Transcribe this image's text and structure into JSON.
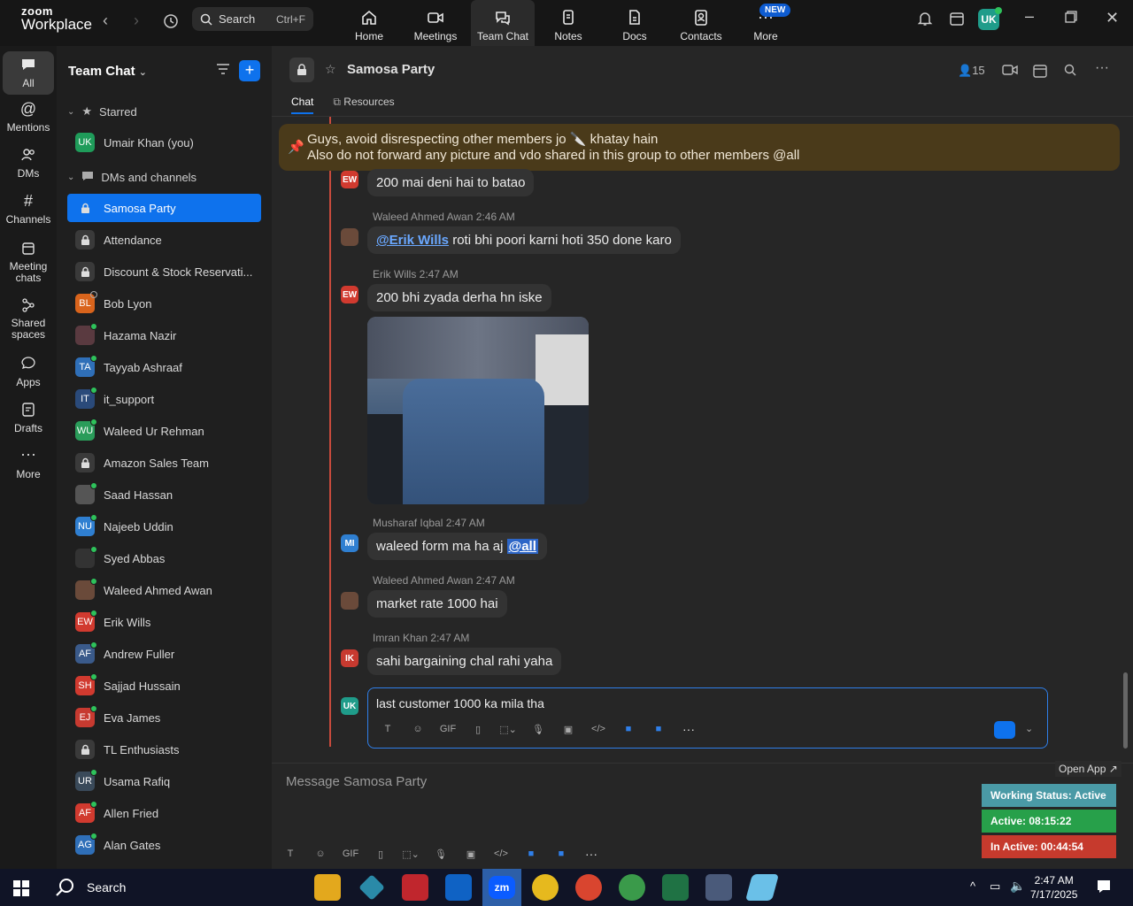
{
  "app": {
    "logo_top": "zoom",
    "logo_bottom": "Workplace"
  },
  "topbar": {
    "search_label": "Search",
    "search_shortcut": "Ctrl+F",
    "tabs": [
      {
        "label": "Home"
      },
      {
        "label": "Meetings"
      },
      {
        "label": "Team Chat"
      },
      {
        "label": "Notes"
      },
      {
        "label": "Docs"
      },
      {
        "label": "Contacts"
      },
      {
        "label": "More"
      }
    ],
    "new_badge": "NEW",
    "user_initials": "UK"
  },
  "rail": {
    "items": [
      {
        "label": "All"
      },
      {
        "label": "Mentions"
      },
      {
        "label": "DMs"
      },
      {
        "label": "Channels"
      },
      {
        "label": "Meeting chats"
      },
      {
        "label": "Shared spaces"
      },
      {
        "label": "Apps"
      },
      {
        "label": "Drafts"
      },
      {
        "label": "More"
      }
    ]
  },
  "sidebar": {
    "title": "Team Chat",
    "starred_label": "Starred",
    "dms_label": "DMs and channels",
    "starred_item": {
      "initials": "UK",
      "name": "Umair Khan (you)",
      "color": "#1f9c5a"
    },
    "items": [
      {
        "name": "Samosa Party",
        "type": "lock"
      },
      {
        "name": "Attendance",
        "type": "lock"
      },
      {
        "name": "Discount & Stock Reservati...",
        "type": "lock"
      },
      {
        "name": "Bob Lyon",
        "initials": "BL",
        "color": "#d9641c",
        "status": "off"
      },
      {
        "name": "Hazama Nazir",
        "initials": "",
        "color": "#5a3a40",
        "status": "on"
      },
      {
        "name": "Tayyab Ashraaf",
        "initials": "TA",
        "color": "#2f6fb8",
        "status": "on"
      },
      {
        "name": "it_support",
        "initials": "IT",
        "color": "#2a4a7a",
        "status": "on"
      },
      {
        "name": "Waleed Ur Rehman",
        "initials": "WU",
        "color": "#2a9c5a",
        "status": "on"
      },
      {
        "name": "Amazon Sales Team",
        "type": "lock"
      },
      {
        "name": "Saad Hassan",
        "initials": "",
        "color": "#555",
        "status": "on"
      },
      {
        "name": "Najeeb Uddin",
        "initials": "NU",
        "color": "#2f7fd1",
        "status": "on"
      },
      {
        "name": "Syed Abbas",
        "initials": "",
        "color": "#333",
        "status": "on"
      },
      {
        "name": "Waleed Ahmed Awan",
        "initials": "",
        "color": "#6a4a3a",
        "status": "on"
      },
      {
        "name": "Erik Wills",
        "initials": "EW",
        "color": "#d13a2f",
        "status": "on"
      },
      {
        "name": "Andrew Fuller",
        "initials": "AF",
        "color": "#3a5a8a",
        "status": "on"
      },
      {
        "name": "Sajjad Hussain",
        "initials": "SH",
        "color": "#d13a2f",
        "status": "on"
      },
      {
        "name": "Eva James",
        "initials": "EJ",
        "color": "#c73a30",
        "status": "on"
      },
      {
        "name": "TL Enthusiasts",
        "type": "lock"
      },
      {
        "name": "Usama Rafiq",
        "initials": "UR",
        "color": "#3a4a5a",
        "status": "on"
      },
      {
        "name": "Allen Fried",
        "initials": "AF",
        "color": "#d13a2f",
        "status": "on"
      },
      {
        "name": "Alan Gates",
        "initials": "AG",
        "color": "#2f6fb8",
        "status": "on"
      }
    ]
  },
  "channel": {
    "title": "Samosa Party",
    "members": "15",
    "tabs": [
      {
        "label": "Chat"
      },
      {
        "label": "Resources"
      }
    ],
    "pinned_line1": "Guys, avoid disrespecting other members jo 🔪 khatay hain",
    "pinned_line2": "Also do not forward any picture and vdo shared in this group to other members @all"
  },
  "messages": [
    {
      "author": "",
      "initials": "EW",
      "color": "#d13a2f",
      "text": "200 mai deni hai to batao"
    },
    {
      "author": "Waleed Ahmed Awan",
      "time": "2:46 AM",
      "initials": "",
      "color": "#6a4a3a",
      "mention": "@Erik Wills",
      "text": " roti bhi poori karni hoti 350 done karo"
    },
    {
      "author": "Erik Wills",
      "time": "2:47 AM",
      "initials": "EW",
      "color": "#d13a2f",
      "text": "200 bhi zyada derha hn iske"
    },
    {
      "author": "Musharaf Iqbal",
      "time": "2:47 AM",
      "initials": "MI",
      "color": "#2f7fd1",
      "text": "waleed form ma ha aj ",
      "mention_all": "@all"
    },
    {
      "author": "Waleed Ahmed Awan",
      "time": "2:47 AM",
      "initials": "",
      "color": "#6a4a3a",
      "text": "market rate 1000 hai"
    },
    {
      "author": "Imran Khan",
      "time": "2:47 AM",
      "initials": "IK",
      "color": "#c73a30",
      "text": "sahi bargaining chal rahi yaha"
    }
  ],
  "reply": {
    "initials": "UK",
    "color": "#1f9c8a",
    "text": "last customer 1000 ka mila tha"
  },
  "composer": {
    "placeholder": "Message Samosa Party",
    "gif": "GIF"
  },
  "widget": {
    "open_app": "Open App ↗",
    "working_status": "Working Status: Active",
    "active": "Active: 08:15:22",
    "inactive": "In Active: 00:44:54"
  },
  "taskbar": {
    "search": "Search",
    "time": "2:47 AM",
    "date": "7/17/2025"
  }
}
